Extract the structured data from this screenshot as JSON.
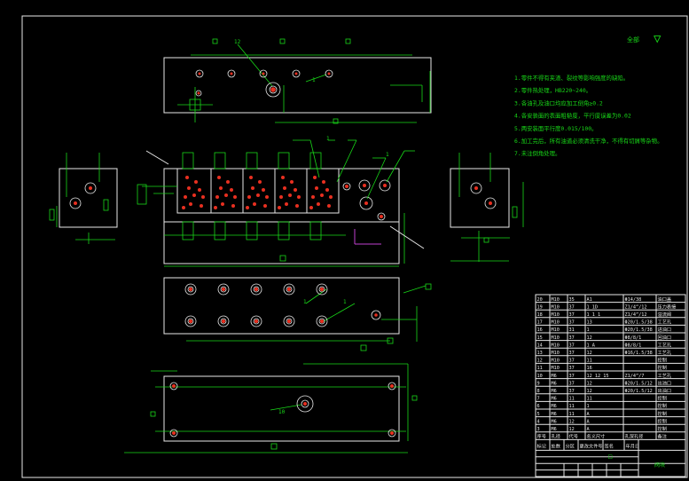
{
  "sheet": {
    "roughness_label": "全部",
    "roughness_symbol": "▽"
  },
  "notes": [
    "1.零件不得有夹渣、裂纹等影响强度的缺陷。",
    "2.零件热处理，HB220~240。",
    "3.各油孔及油口均应加工倒角≥0.2",
    "4.各安装面的表面粗糙度，平行度误差为0.02",
    "5.两安装面平行度0.015/100。",
    "6.加工完后，所有油道必须清洗干净，不得有切屑等杂物。",
    "7.未注倒角处理。"
  ],
  "title_block": {
    "rows": [
      [
        "20",
        "M10",
        "35",
        "A1",
        "Φ14/38",
        "油口盖"
      ],
      [
        "19",
        "M10",
        "37",
        "1  1D",
        "Z1/4”/12",
        "压力表接"
      ],
      [
        "18",
        "M10",
        "37",
        "1  1  1",
        "Z1/4”/12",
        "溢流阀"
      ],
      [
        "17",
        "M10",
        "37",
        "13",
        "Φ20/1.5/38",
        "工艺孔"
      ],
      [
        "16",
        "M10",
        "31",
        "1",
        "Φ20/1.5/38",
        "进油口"
      ],
      [
        "15",
        "M10",
        "37",
        "12",
        "Φ8/8/1",
        "回油口"
      ],
      [
        "14",
        "M10",
        "37",
        "1  A",
        "Φ8/8/1",
        "工艺孔"
      ],
      [
        "13",
        "M10",
        "37",
        "12",
        "Φ16/1.5/38",
        "工艺孔"
      ],
      [
        "12",
        "M10",
        "37",
        "11",
        "",
        "控制"
      ],
      [
        "11",
        "M10",
        "37",
        "16",
        "",
        "控制"
      ],
      [
        "10",
        "M6",
        "37",
        "12  12  15",
        "Z1/4”/7",
        "工艺孔"
      ],
      [
        "9",
        "M6",
        "37",
        "12",
        "Φ20/1.5/12",
        "出油口"
      ],
      [
        "8",
        "M6",
        "37",
        "12",
        "Φ20/1.5/12",
        "出油口"
      ],
      [
        "7",
        "M6",
        "11",
        "11",
        "",
        "控制"
      ],
      [
        "6",
        "M6",
        "11",
        "1",
        "",
        "控制"
      ],
      [
        "5",
        "M6",
        "11",
        "A",
        "",
        "控制"
      ],
      [
        "4",
        "M6",
        "12",
        "A",
        "",
        "控制"
      ],
      [
        "3",
        "M6",
        "12",
        "A",
        "",
        "控制"
      ]
    ],
    "header": [
      "序号",
      "孔径",
      "代号",
      "名义尺寸",
      "孔深孔径",
      "备注"
    ],
    "sign_row": [
      "标记",
      "处数",
      "分区",
      "更改文件号",
      "签名",
      "年月日"
    ],
    "part_label": "阀块",
    "scale_box": "□"
  },
  "callouts": {
    "top": "12",
    "side": "1",
    "main_left": "1",
    "main_right": "1",
    "bottom_a": "1",
    "bottom_b": "1",
    "foot": "10"
  }
}
